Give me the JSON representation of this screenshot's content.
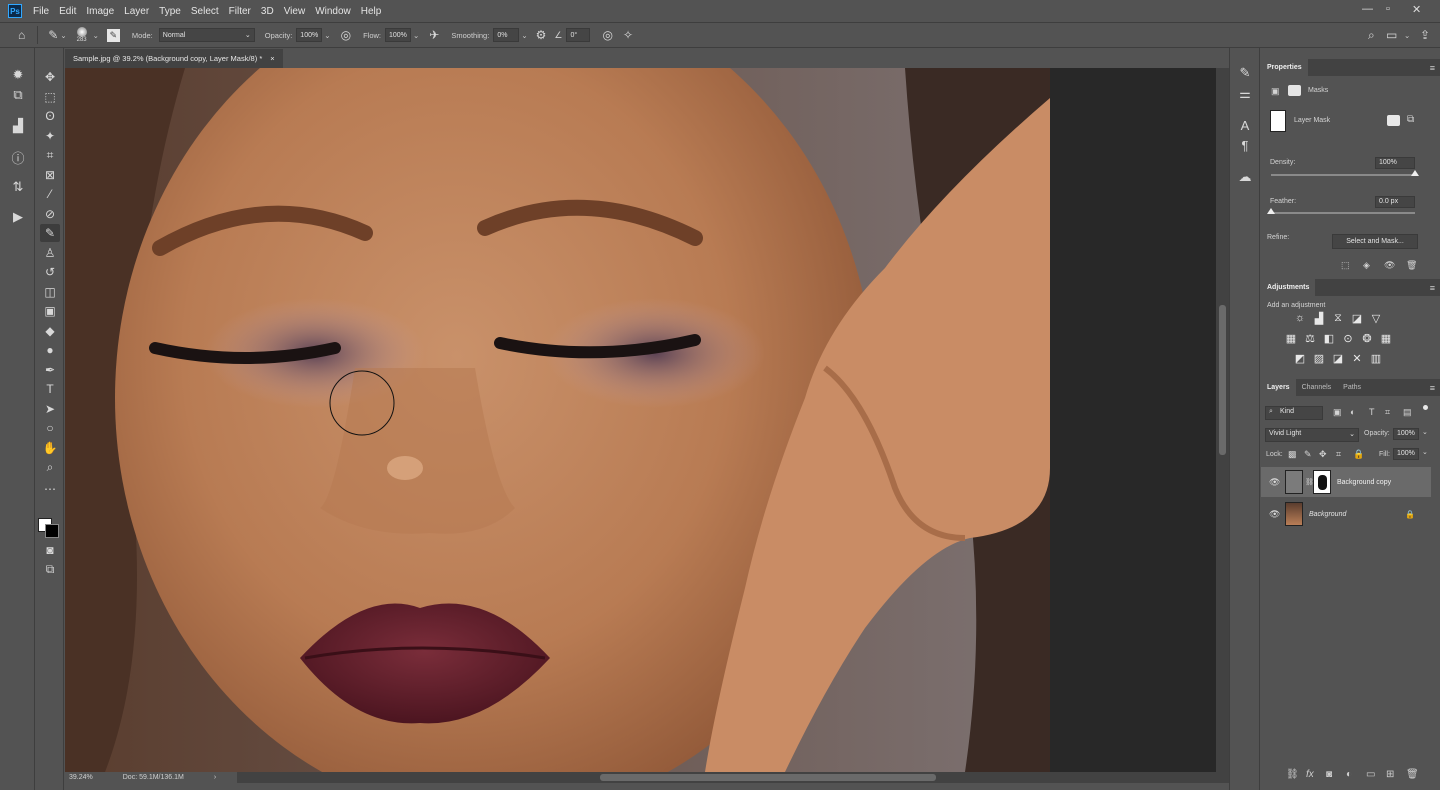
{
  "app": {
    "logo": "Ps"
  },
  "menu": [
    "File",
    "Edit",
    "Image",
    "Layer",
    "Type",
    "Select",
    "Filter",
    "3D",
    "View",
    "Window",
    "Help"
  ],
  "options": {
    "brush_size": "283",
    "mode_label": "Mode:",
    "mode_value": "Normal",
    "opacity_label": "Opacity:",
    "opacity_value": "100%",
    "flow_label": "Flow:",
    "flow_value": "100%",
    "smoothing_label": "Smoothing:",
    "smoothing_value": "0%",
    "angle_value": "0°"
  },
  "document": {
    "tab_title": "Sample.jpg @ 39.2% (Background copy, Layer Mask/8) *",
    "close": "×",
    "zoom": "39.24%",
    "doc_info": "Doc: 59.1M/136.1M",
    "status_arrow": "›"
  },
  "properties": {
    "title": "Properties",
    "masks_label": "Masks",
    "layer_mask_label": "Layer Mask",
    "density_label": "Density:",
    "density_value": "100%",
    "density_fraction": 1.0,
    "feather_label": "Feather:",
    "feather_value": "0.0 px",
    "feather_fraction": 0.0,
    "refine_label": "Refine:",
    "select_and_mask": "Select and Mask..."
  },
  "adjustments": {
    "title": "Adjustments",
    "add_label": "Add an adjustment"
  },
  "layers_panel": {
    "tabs": [
      "Layers",
      "Channels",
      "Paths"
    ],
    "kind_label": "Kind",
    "blend_mode": "Vivid Light",
    "opacity_label": "Opacity:",
    "opacity_value": "100%",
    "lock_label": "Lock:",
    "fill_label": "Fill:",
    "fill_value": "100%",
    "layers": [
      {
        "name": "Background copy",
        "selected": true
      },
      {
        "name": "Background",
        "selected": false,
        "locked": true
      }
    ]
  },
  "icons": {
    "eye": "eye-icon",
    "lock": "lock-icon",
    "home": "home-icon",
    "search": "search-icon"
  }
}
